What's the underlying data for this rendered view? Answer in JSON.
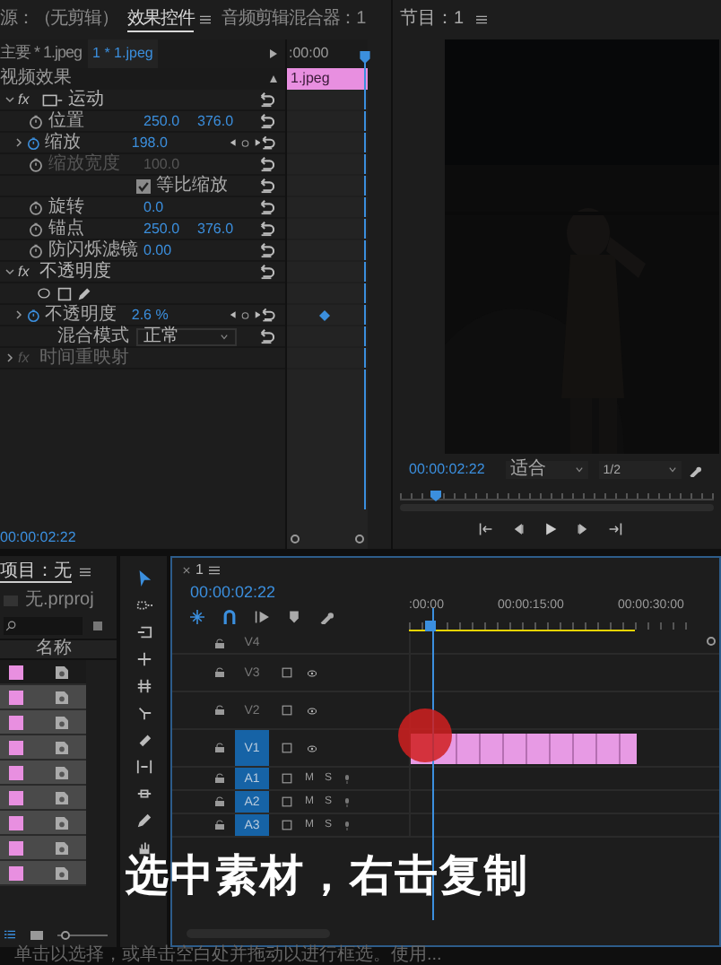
{
  "source_tabs": [
    {
      "label": "源：（无剪辑）",
      "selected": false
    },
    {
      "label": "效果控件",
      "selected": true
    },
    {
      "label": "音频剪辑混合器：1",
      "selected": false
    }
  ],
  "effect_controls": {
    "master_clip": "主要 * 1.jpeg",
    "sequence_clip": "1 * 1.jpeg",
    "section_title": "视频效果",
    "ruler_time": ":00:00",
    "clip_label": "1.jpeg",
    "timecode": "00:00:02:22",
    "rows": [
      {
        "kind": "effect",
        "name": "运动",
        "badge": "fx",
        "expanded": true,
        "enabled": true
      },
      {
        "kind": "param",
        "name": "位置",
        "values": [
          "250.0",
          "376.0"
        ],
        "animated": false,
        "disabled": false,
        "keyframe_visible": false
      },
      {
        "kind": "param",
        "name": "缩放",
        "values": [
          "198.0"
        ],
        "animated": true,
        "disabled": false,
        "keyframe_visible": false
      },
      {
        "kind": "param",
        "name": "缩放宽度",
        "values": [
          "100.0"
        ],
        "animated": false,
        "disabled": true,
        "keyframe_visible": false
      },
      {
        "kind": "checkbox",
        "name": "等比缩放",
        "checked": true
      },
      {
        "kind": "param",
        "name": "旋转",
        "values": [
          "0.0"
        ],
        "animated": false,
        "disabled": false,
        "keyframe_visible": false
      },
      {
        "kind": "param",
        "name": "锚点",
        "values": [
          "250.0",
          "376.0"
        ],
        "animated": false,
        "disabled": false,
        "keyframe_visible": false
      },
      {
        "kind": "param",
        "name": "防闪烁滤镜",
        "values": [
          "0.00"
        ],
        "animated": false,
        "disabled": false,
        "keyframe_visible": false
      },
      {
        "kind": "effect",
        "name": "不透明度",
        "badge": "fx",
        "expanded": true,
        "enabled": true
      },
      {
        "kind": "shapes"
      },
      {
        "kind": "param",
        "name": "不透明度",
        "values": [
          "2.6 %"
        ],
        "animated": true,
        "disabled": false,
        "keyframe_visible": true
      },
      {
        "kind": "dropdown",
        "name": "混合模式",
        "value": "正常"
      },
      {
        "kind": "effect",
        "name": "时间重映射",
        "badge": "fx",
        "expanded": false,
        "enabled": false
      }
    ]
  },
  "program_monitor": {
    "title": "节目：1",
    "timecode": "00:00:02:22",
    "zoom": "适合",
    "resolution": "1/2"
  },
  "project": {
    "title": "项目：无",
    "file": "无.prproj",
    "column": "名称",
    "items": [
      {
        "selected": true
      },
      {
        "selected": false
      },
      {
        "selected": false
      },
      {
        "selected": false
      },
      {
        "selected": false
      },
      {
        "selected": false
      },
      {
        "selected": false
      },
      {
        "selected": false
      },
      {
        "selected": false
      }
    ],
    "zoom_slider": {
      "level": 0.1
    }
  },
  "timeline": {
    "tab": "1",
    "timecode": "00:00:02:22",
    "ruler_labels": [
      ":00:00",
      "00:00:15:00",
      "00:00:30:00"
    ],
    "tracks": [
      {
        "name": "V4",
        "kind": "video",
        "targeted": false
      },
      {
        "name": "V3",
        "kind": "video",
        "targeted": false
      },
      {
        "name": "V2",
        "kind": "video",
        "targeted": false
      },
      {
        "name": "V1",
        "kind": "video",
        "targeted": true
      },
      {
        "name": "A1",
        "kind": "audio",
        "targeted": true,
        "mute_label": "M",
        "solo_label": "S"
      },
      {
        "name": "A2",
        "kind": "audio",
        "targeted": true,
        "mute_label": "M",
        "solo_label": "S"
      },
      {
        "name": "A3",
        "kind": "audio",
        "targeted": true,
        "mute_label": "M",
        "solo_label": "S"
      }
    ]
  },
  "caption": "选中素材，右击复制",
  "status_bar": "单击以选择，或单击空白处并拖动以进行框选。使用..."
}
